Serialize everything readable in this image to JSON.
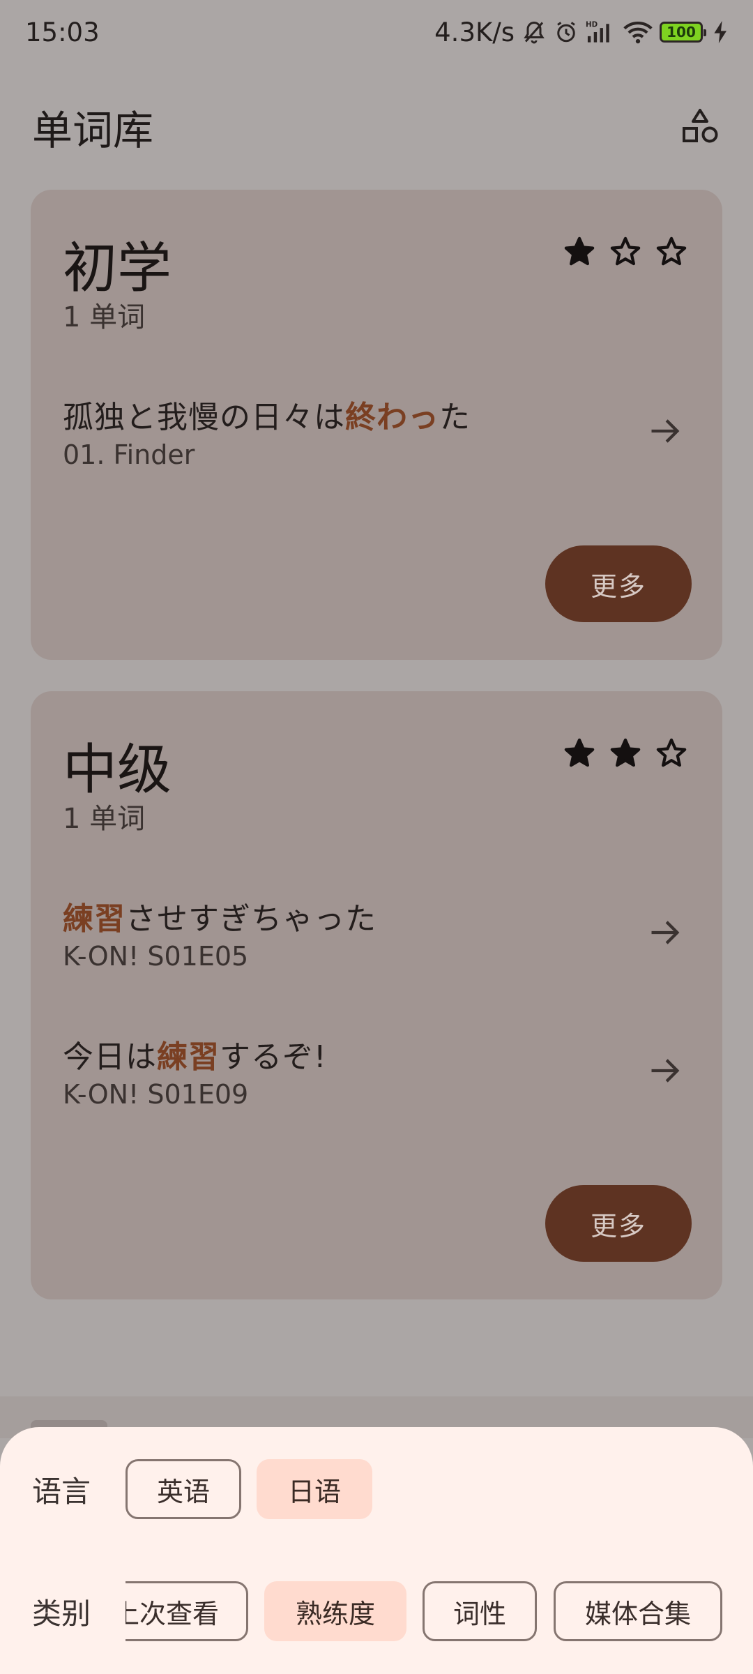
{
  "status_bar": {
    "time": "15:03",
    "network_speed": "4.3K/s",
    "icons": [
      "bell-muted-icon",
      "alarm-icon",
      "hd-signal-icon",
      "wifi-icon",
      "battery-icon",
      "charging-icon"
    ],
    "battery_level": "100"
  },
  "app_bar": {
    "title": "单词库",
    "action_icon": "shapes-icon"
  },
  "cards": [
    {
      "title": "初学",
      "count": "1 单词",
      "stars_filled": 1,
      "stars_total": 3,
      "entries": [
        {
          "sentence_before": "孤独と我慢の日々は",
          "sentence_highlight": "終わっ",
          "sentence_after": "た",
          "source": "01. Finder"
        }
      ],
      "more_label": "更多"
    },
    {
      "title": "中级",
      "count": "1 单词",
      "stars_filled": 2,
      "stars_total": 3,
      "entries": [
        {
          "sentence_before": "",
          "sentence_highlight": "練習",
          "sentence_after": "させすぎちゃった",
          "source": "K-ON! S01E05"
        },
        {
          "sentence_before": "今日は",
          "sentence_highlight": "練習",
          "sentence_after": "するぞ!",
          "source": "K-ON! S01E09"
        }
      ],
      "more_label": "更多"
    }
  ],
  "filters": {
    "language": {
      "label": "语言",
      "chips": [
        {
          "label": "英语",
          "selected": false
        },
        {
          "label": "日语",
          "selected": true
        }
      ]
    },
    "category": {
      "label": "类别",
      "chips": [
        {
          "label": "上次查看",
          "selected": false
        },
        {
          "label": "熟练度",
          "selected": true
        },
        {
          "label": "词性",
          "selected": false
        },
        {
          "label": "媒体合集",
          "selected": false
        }
      ]
    }
  },
  "colors": {
    "background_scrim": "#aba6a5",
    "card": "#a19592",
    "highlight": "#7a3f22",
    "more_button": "#5e3322",
    "sheet": "#fff1ec",
    "chip_selected": "#ffdbcf"
  }
}
